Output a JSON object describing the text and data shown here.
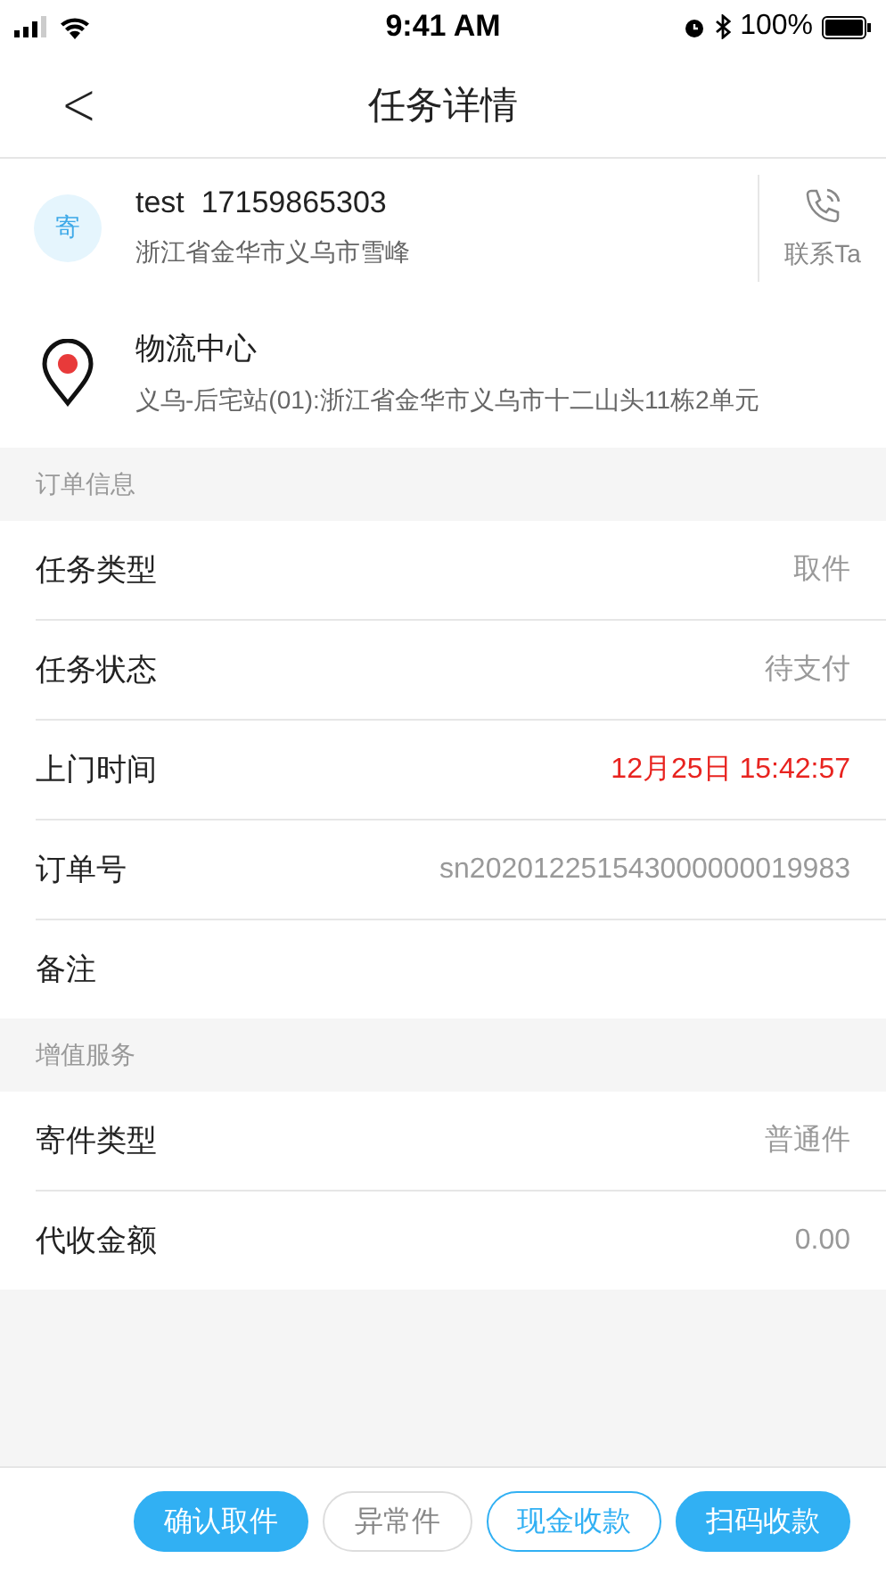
{
  "status_bar": {
    "time": "9:41 AM",
    "battery": "100%"
  },
  "nav": {
    "back": "<",
    "title": "任务详情"
  },
  "sender": {
    "badge": "寄",
    "name": "test",
    "phone": "17159865303",
    "address": "浙江省金华市义乌市雪峰",
    "contact": "联系Ta"
  },
  "destination": {
    "name": "物流中心",
    "address": "义乌-后宅站(01):浙江省金华市义乌市十二山头11栋2单元"
  },
  "sections": [
    {
      "title": "订单信息",
      "rows": [
        {
          "label": "任务类型",
          "value": "取件"
        },
        {
          "label": "任务状态",
          "value": "待支付"
        },
        {
          "label": "上门时间",
          "value": "12月25日 15:42:57",
          "emphasis": true
        },
        {
          "label": "订单号",
          "value": "sn202012251543000000019983"
        },
        {
          "label": "备注"
        }
      ]
    },
    {
      "title": "增值服务",
      "rows": [
        {
          "label": "寄件类型",
          "value": "普通件"
        },
        {
          "label": "代收金额",
          "value": "0.00"
        }
      ]
    }
  ],
  "actions": [
    {
      "label": "确认取件",
      "kind": "filled"
    },
    {
      "label": "异常件",
      "kind": "plain"
    },
    {
      "label": "现金收款",
      "kind": "outline"
    },
    {
      "label": "扫码收款",
      "kind": "filled"
    }
  ]
}
